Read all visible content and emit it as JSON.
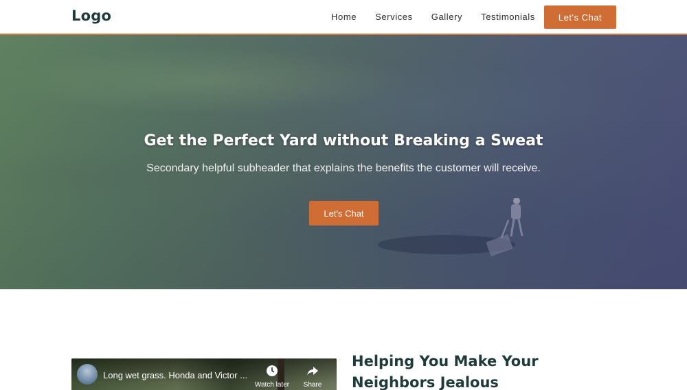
{
  "header": {
    "logo": "Logo",
    "nav": [
      "Home",
      "Services",
      "Gallery",
      "Testimonials"
    ],
    "cta_label": "Let's Chat",
    "accent_color": "#d8783a"
  },
  "hero": {
    "title": "Get the Perfect Yard without Breaking a Sweat",
    "subtitle": "Secondary helpful subheader that explains the benefits the customer will receive.",
    "cta_label": "Let's Chat"
  },
  "video": {
    "title": "Long wet grass. Honda and Victor ...",
    "watch_later_label": "Watch later",
    "share_label": "Share",
    "watch_later_icon": "clock-icon",
    "share_icon": "share-icon"
  },
  "section": {
    "title": "Helping You Make Your Neighbors Jealous"
  }
}
